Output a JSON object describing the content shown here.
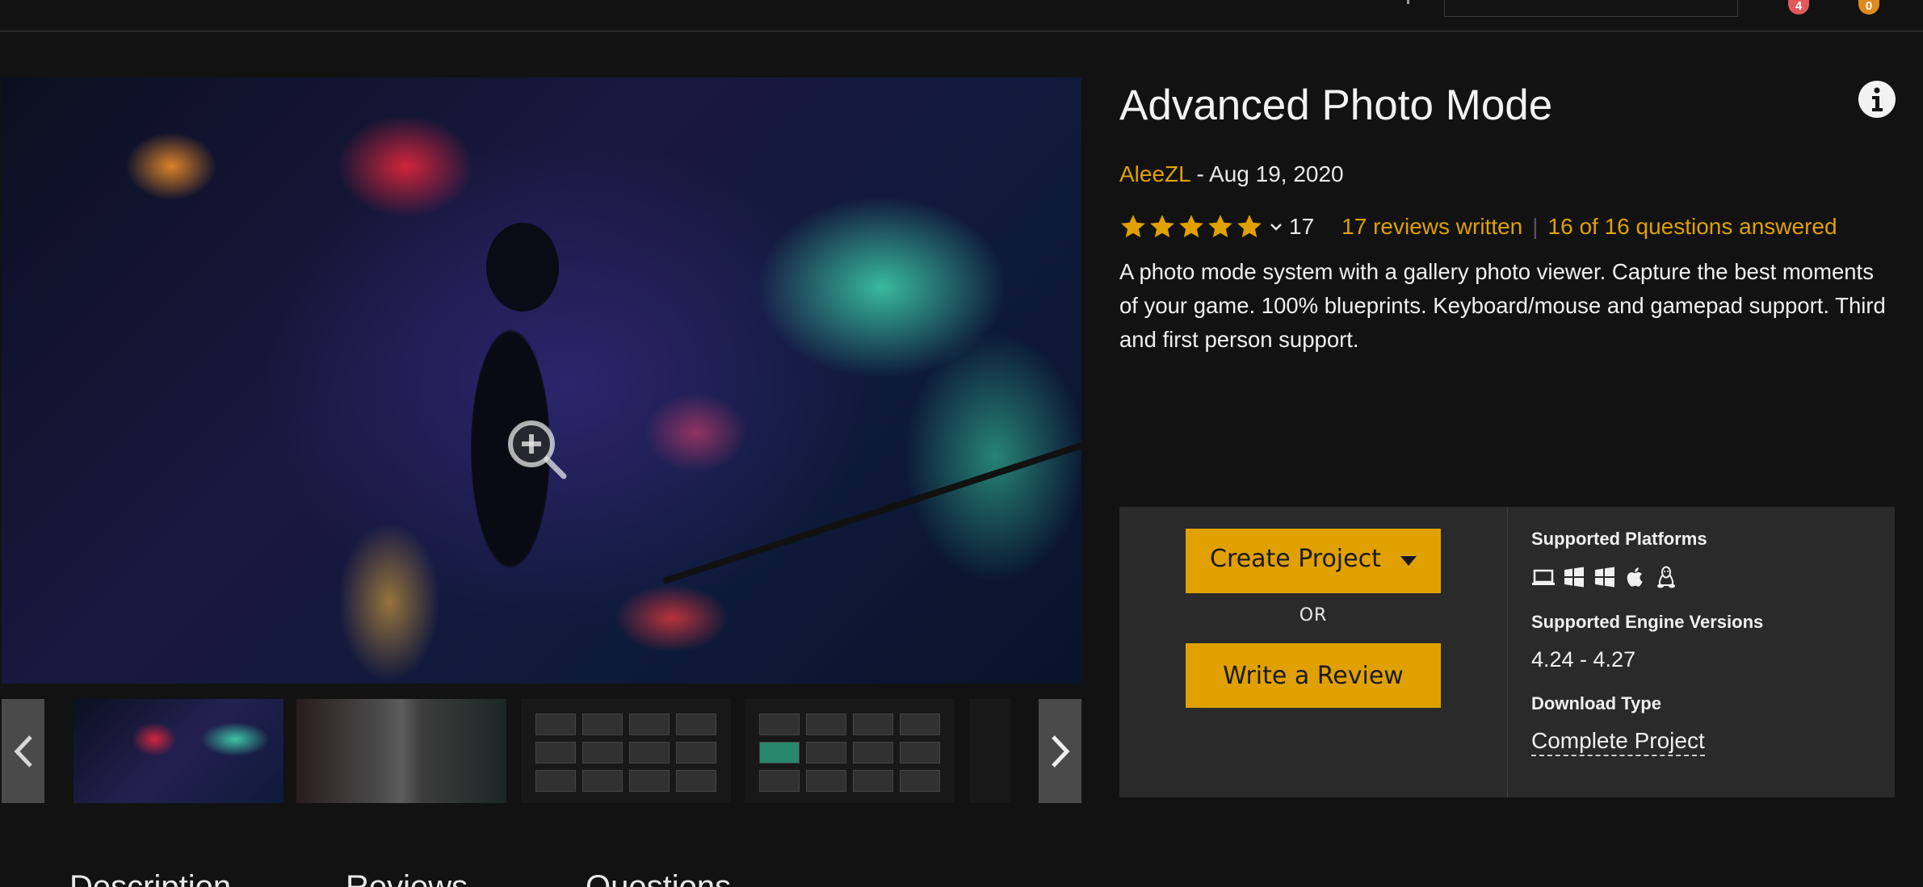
{
  "notifications": {
    "cart_count": "4",
    "notification_count": "0"
  },
  "product": {
    "title": "Advanced Photo Mode",
    "author": "AleeZL",
    "date_separator": " - ",
    "date": "Aug 19, 2020",
    "rating": {
      "stars": 5,
      "max_stars": 5,
      "count": "17"
    },
    "reviews_link": "17 reviews written",
    "rating_separator": "|",
    "questions_link": "16 of 16 questions answered",
    "description": "A photo mode system with a gallery photo viewer. Capture the best moments of your game. 100% blueprints. Keyboard/mouse and gamepad support. Third and first person support."
  },
  "gallery": {
    "thumbnails": [
      "thumbnail-1",
      "thumbnail-2",
      "thumbnail-3",
      "thumbnail-4",
      "thumbnail-5"
    ],
    "selected_index": 0,
    "icons": {
      "zoom": "zoom-in-icon",
      "prev": "chevron-left-icon",
      "next": "chevron-right-icon"
    }
  },
  "actions": {
    "create_project": "Create Project",
    "or_label": "OR",
    "write_review": "Write a Review"
  },
  "details": {
    "platforms_heading": "Supported Platforms",
    "platforms": [
      "desktop-icon",
      "windows-icon",
      "windows-icon",
      "apple-icon",
      "linux-icon"
    ],
    "engine_heading": "Supported Engine Versions",
    "engine_versions": "4.24 - 4.27",
    "download_heading": "Download Type",
    "download_type": "Complete Project"
  },
  "tabs": {
    "description": "Description",
    "reviews": "Reviews",
    "questions": "Questions"
  },
  "colors": {
    "accent": "#e0a100",
    "background": "#121212",
    "panel": "#2a2a2a"
  }
}
